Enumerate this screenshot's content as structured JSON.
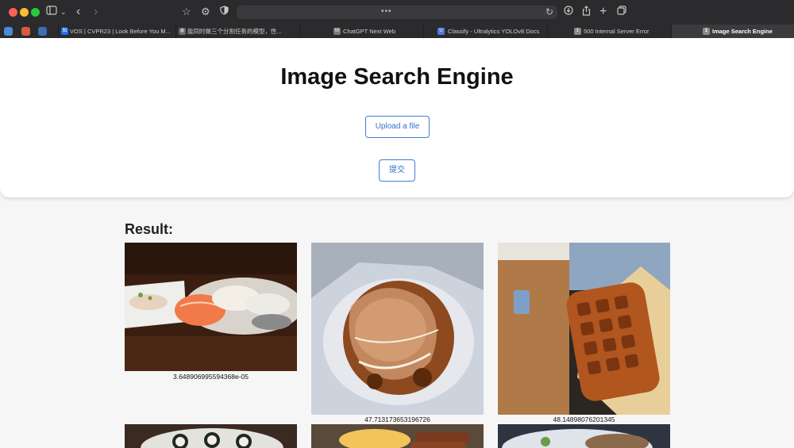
{
  "browser": {
    "toolbar_icons": [
      "sidebar-icon",
      "chevron-down-icon",
      "back-icon",
      "forward-icon",
      "star-icon",
      "gear-icon",
      "shield-icon",
      "reload-icon",
      "download-icon",
      "share-icon",
      "plus-icon",
      "tabs-overview-icon"
    ],
    "address_dots": "•••",
    "tabs": [
      {
        "label": "VOS | CVPR23 | Look Before You M...",
        "favicon": "知",
        "favicon_color": "#1772f6"
      },
      {
        "label": "能同时做三个分割任务的模型，性...",
        "favicon": "◍",
        "favicon_color": "#6b6b6b"
      },
      {
        "label": "ChatGPT Next Web",
        "favicon": "M",
        "favicon_color": "#7a7a7a"
      },
      {
        "label": "Classify - Ultralytics YOLOv8 Docs",
        "favicon": "U",
        "favicon_color": "#4b7bd8"
      },
      {
        "label": "500 Internal Server Error",
        "favicon": "1",
        "favicon_color": "#8a8a8a"
      },
      {
        "label": "Image Search Engine",
        "favicon": "1",
        "favicon_color": "#8a8a8a"
      }
    ]
  },
  "page": {
    "title": "Image Search Engine",
    "upload_label": "Upload a file",
    "submit_label": "提交",
    "result_heading": "Result:"
  },
  "results": [
    {
      "score": "3.648906995594368e-05",
      "desc": "sashimi-plate-image"
    },
    {
      "score": "47.713173653196726",
      "desc": "takoyaki-image"
    },
    {
      "score": "48.14898076201345",
      "desc": "waffle-coffee-image"
    },
    {
      "score": "",
      "desc": "sushi-rolls-image"
    },
    {
      "score": "",
      "desc": "sausages-fries-image"
    },
    {
      "score": "",
      "desc": "plated-dish-image"
    }
  ],
  "colors": {
    "accent": "#2f72cf",
    "chrome_bg": "#2b2b2d",
    "page_bg": "#f6f6f6"
  }
}
